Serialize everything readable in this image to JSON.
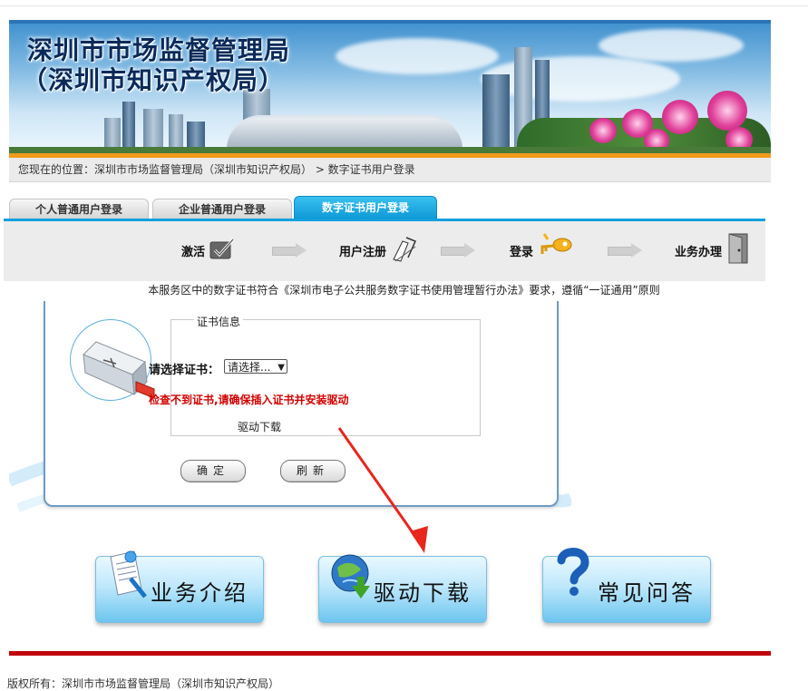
{
  "banner": {
    "title_line1": "深圳市市场监督管理局",
    "title_line2": "（深圳市知识产权局）"
  },
  "breadcrumb": {
    "text": "您现在的位置：深圳市市场监督管理局（深圳市知识产权局） > 数字证书用户登录"
  },
  "tabs": [
    {
      "label": "个人普通用户登录",
      "active": false
    },
    {
      "label": "企业普通用户登录",
      "active": false
    },
    {
      "label": "数字证书用户登录",
      "active": true
    }
  ],
  "steps": [
    {
      "label": "激活",
      "icon": "checkbox-icon"
    },
    {
      "label": "用户注册",
      "icon": "pen-icon"
    },
    {
      "label": "登录",
      "icon": "key-icon"
    },
    {
      "label": "业务办理",
      "icon": "door-icon"
    }
  ],
  "notice": "本服务区中的数字证书符合《深圳市电子公共服务数字证书使用管理暂行办法》要求，遵循“一证通用”原则",
  "cert": {
    "legend": "证书信息",
    "select_label": "请选择证书：",
    "select_value": "请选择...",
    "error": "检查不到证书,请确保插入证书并安装驱动",
    "driver_link": "驱动下载",
    "ok_button": "确定",
    "refresh_button": "刷新"
  },
  "big_buttons": [
    {
      "label": "业务介绍",
      "icon": "document-icon"
    },
    {
      "label": "驱动下载",
      "icon": "globe-download-icon"
    },
    {
      "label": "常见问答",
      "icon": "question-icon"
    }
  ],
  "footer": {
    "text": "版权所有：深圳市市场监督管理局（深圳市知识产权局）"
  },
  "colors": {
    "accent_blue": "#12a0de",
    "orange_bar": "#f39a1b",
    "footer_red": "#c1000a",
    "error_red": "#d40000"
  }
}
